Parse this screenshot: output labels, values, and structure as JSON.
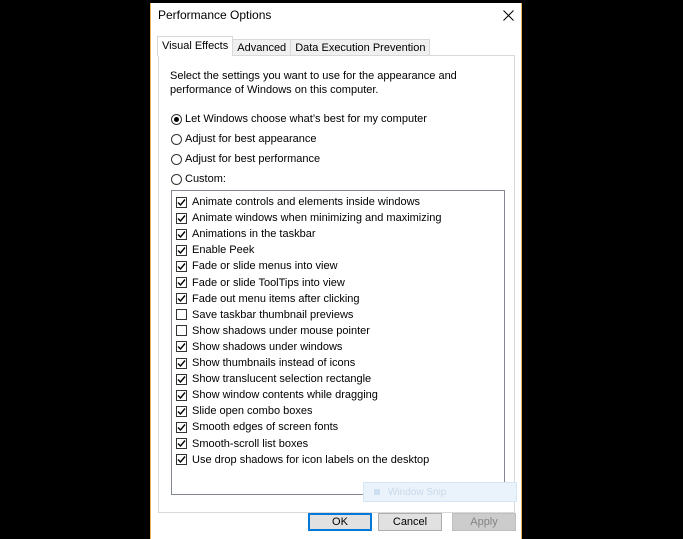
{
  "window": {
    "title": "Performance Options"
  },
  "tabs": [
    {
      "label": "Visual Effects",
      "active": true
    },
    {
      "label": "Advanced",
      "active": false
    },
    {
      "label": "Data Execution Prevention",
      "active": false
    }
  ],
  "intro": "Select the settings you want to use for the appearance and performance of Windows on this computer.",
  "options": [
    {
      "label": "Let Windows choose what’s best for my computer",
      "selected": true
    },
    {
      "label": "Adjust for best appearance",
      "selected": false
    },
    {
      "label": "Adjust for best performance",
      "selected": false
    },
    {
      "label": "Custom:",
      "selected": false
    }
  ],
  "effects": [
    {
      "label": "Animate controls and elements inside windows",
      "checked": true
    },
    {
      "label": "Animate windows when minimizing and maximizing",
      "checked": true
    },
    {
      "label": "Animations in the taskbar",
      "checked": true
    },
    {
      "label": "Enable Peek",
      "checked": true
    },
    {
      "label": "Fade or slide menus into view",
      "checked": true
    },
    {
      "label": "Fade or slide ToolTips into view",
      "checked": true
    },
    {
      "label": "Fade out menu items after clicking",
      "checked": true
    },
    {
      "label": "Save taskbar thumbnail previews",
      "checked": false
    },
    {
      "label": "Show shadows under mouse pointer",
      "checked": false
    },
    {
      "label": "Show shadows under windows",
      "checked": true
    },
    {
      "label": "Show thumbnails instead of icons",
      "checked": true
    },
    {
      "label": "Show translucent selection rectangle",
      "checked": true
    },
    {
      "label": "Show window contents while dragging",
      "checked": true
    },
    {
      "label": "Slide open combo boxes",
      "checked": true
    },
    {
      "label": "Smooth edges of screen fonts",
      "checked": true
    },
    {
      "label": "Smooth-scroll list boxes",
      "checked": true
    },
    {
      "label": "Use drop shadows for icon labels on the desktop",
      "checked": true
    }
  ],
  "ghost_overlay": "Window Snip",
  "buttons": {
    "ok": "OK",
    "cancel": "Cancel",
    "apply": "Apply"
  },
  "icons": {
    "close": "close-icon",
    "check": "check-icon"
  }
}
